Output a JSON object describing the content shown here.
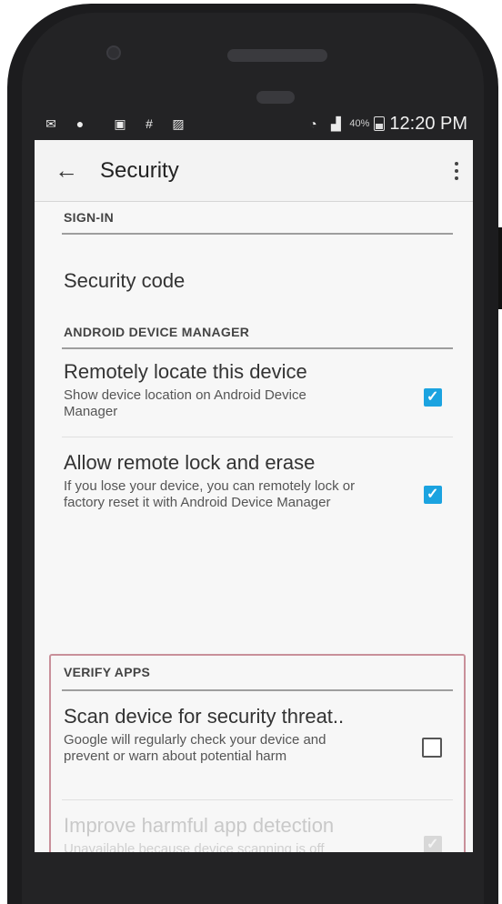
{
  "status_bar": {
    "left_icons": [
      "mail-icon",
      "location-icon",
      "image-icon",
      "hash-icon",
      "gallery-icon"
    ],
    "battery_percent": "40%",
    "time": "12:20 PM"
  },
  "app_bar": {
    "title": "Security"
  },
  "sections": {
    "sign_in": {
      "header": "SIGN-IN",
      "security_code_label": "Security code"
    },
    "device_manager": {
      "header": "ANDROID DEVICE MANAGER",
      "remote_locate": {
        "title": "Remotely locate this device",
        "subtitle": "Show device location on Android Device Manager",
        "checked": true
      },
      "remote_lock": {
        "title": "Allow remote lock and erase",
        "subtitle": "If you lose your device, you can remotely lock or factory reset it with Android Device Manager",
        "checked": true
      }
    },
    "verify_apps": {
      "header": "VERIFY APPS",
      "scan": {
        "title": "Scan device for security threat..",
        "subtitle": "Google will regularly check your device and prevent or warn about potential harm",
        "checked": false
      },
      "improve": {
        "title": "Improve harmful app detection",
        "subtitle": "Unavailable because device scanning is off",
        "checked": true,
        "enabled": false
      }
    }
  },
  "colors": {
    "accent": "#1ba3e0",
    "highlight_border": "#c9909a"
  }
}
